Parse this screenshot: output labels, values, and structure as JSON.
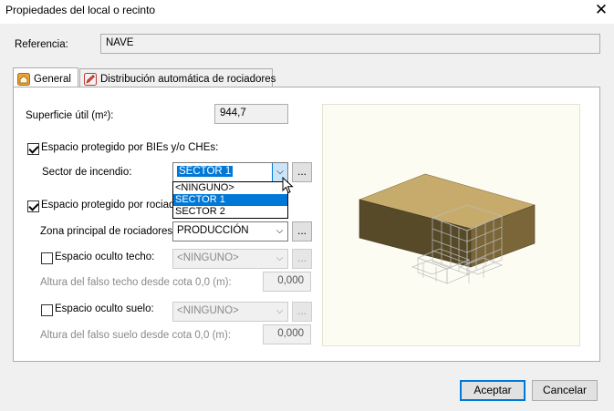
{
  "window": {
    "title": "Propiedades del local o recinto"
  },
  "referencia": {
    "label": "Referencia:",
    "value": "NAVE"
  },
  "tabs": [
    {
      "label": "General",
      "icon": "house-icon"
    },
    {
      "label": "Distribución automática de rociadores",
      "icon": "pencil-icon"
    }
  ],
  "general": {
    "superficie_label": "Superficie útil (m²):",
    "superficie_value": "944,7",
    "bies_label": "Espacio protegido por BIEs y/o CHEs:",
    "sector_label": "Sector de incendio:",
    "sector_value": "SECTOR 1",
    "sector_options": [
      "<NINGUNO>",
      "SECTOR 1",
      "SECTOR 2"
    ],
    "rociadores_label": "Espacio protegido por rociador",
    "zona_label": "Zona principal de rociadores:",
    "zona_value": "PRODUCCIÓN",
    "techo_label": "Espacio oculto techo:",
    "techo_value": "<NINGUNO>",
    "altura_techo_label": "Altura del falso techo desde cota 0,0 (m):",
    "altura_techo_value": "0,000",
    "suelo_label": "Espacio oculto suelo:",
    "suelo_value": "<NINGUNO>",
    "altura_suelo_label": "Altura del falso suelo desde cota 0,0 (m):",
    "altura_suelo_value": "0,000",
    "dots": "..."
  },
  "buttons": {
    "accept": "Aceptar",
    "cancel": "Cancelar"
  },
  "colors": {
    "accent": "#0078d7",
    "building": "#b49a5c"
  }
}
